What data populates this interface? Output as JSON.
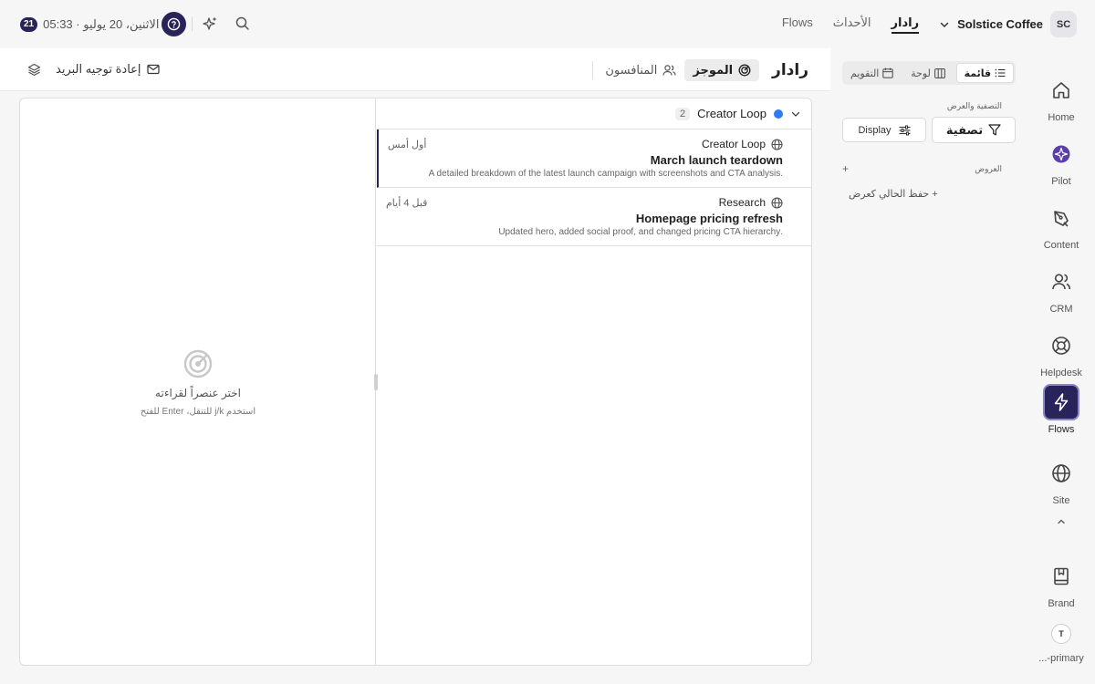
{
  "topbar": {
    "notification_count": "21",
    "datetime": "الاثنين، 20 يوليو · 05:33",
    "workspace_initials": "SC",
    "workspace_name": "Solstice Coffee",
    "nav": [
      {
        "label": "Flows"
      },
      {
        "label": "الأحداث"
      },
      {
        "label": "رادار"
      }
    ]
  },
  "header": {
    "title": "رادار",
    "tabs": [
      {
        "label": "الموجز",
        "icon": "radar-icon"
      },
      {
        "label": "المنافسون",
        "icon": "users-icon"
      }
    ],
    "mail_forward_label": "إعادة توجيه البريد"
  },
  "rail": {
    "items": [
      {
        "label": "Home",
        "icon": "home-icon"
      },
      {
        "label": "Pilot",
        "icon": "pilot-icon"
      },
      {
        "label": "Content",
        "icon": "pen-icon"
      },
      {
        "label": "CRM",
        "icon": "users-icon"
      },
      {
        "label": "Helpdesk",
        "icon": "lifebuoy-icon"
      },
      {
        "label": "Flows",
        "icon": "zap-icon"
      },
      {
        "label": "Site",
        "icon": "globe-icon"
      },
      {
        "label": "Brand",
        "icon": "book-icon"
      }
    ],
    "user_initial": "T",
    "user_label": "...-primary"
  },
  "filter_panel": {
    "view_modes": [
      {
        "label": "قائمة",
        "icon": "list-icon"
      },
      {
        "label": "لوحة",
        "icon": "columns-icon"
      },
      {
        "label": "التقويم",
        "icon": "calendar-icon"
      }
    ],
    "filter_section_label": "التصفية والعرض",
    "filter_button": "تصفية",
    "display_button": "Display",
    "views_label": "العروض",
    "views_add": "+",
    "save_view": "+ حفظ الحالي كعرض"
  },
  "reader": {
    "empty_title": "اختر عنصراً لقراءته",
    "empty_hint": "استخدم j/k للتنقل، Enter للفتح"
  },
  "feed": {
    "group": {
      "name": "Creator Loop",
      "count": "2",
      "color": "#2f7bf5"
    },
    "items": [
      {
        "source": "Creator Loop",
        "time": "أول أمس",
        "title": "March launch teardown",
        "description": ".A detailed breakdown of the latest launch campaign with screenshots and CTA analysis"
      },
      {
        "source": "Research",
        "time": "قبل 4 أيام",
        "title": "Homepage pricing refresh",
        "description": ".Updated hero, added social proof, and changed pricing CTA hierarchy"
      }
    ]
  },
  "colors": {
    "accent": "#28245a",
    "group_dot": "#2f7bf5"
  }
}
